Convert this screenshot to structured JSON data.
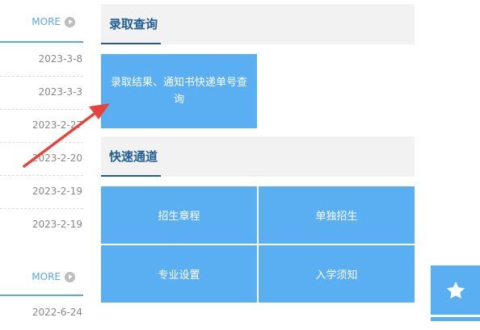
{
  "news_top": {
    "more_label": "MORE",
    "dates": [
      "2023-3-8",
      "2023-3-3",
      "2023-2-27",
      "2023-2-20",
      "2023-2-19",
      "2023-2-19"
    ]
  },
  "news_bottom": {
    "more_label": "MORE",
    "dates": [
      "2022-6-24"
    ]
  },
  "admission_query": {
    "title": "录取查询",
    "tile_label": "录取结果、通知书快递单号查询"
  },
  "quick_access": {
    "title": "快速通道",
    "tiles": [
      "招生章程",
      "单独招生",
      "专业设置",
      "入学须知"
    ]
  },
  "colors": {
    "accent": "#5aaef2",
    "heading": "#1f5e94",
    "annotation_arrow": "#e8433a"
  },
  "floating_button": {
    "icon": "star-icon"
  }
}
